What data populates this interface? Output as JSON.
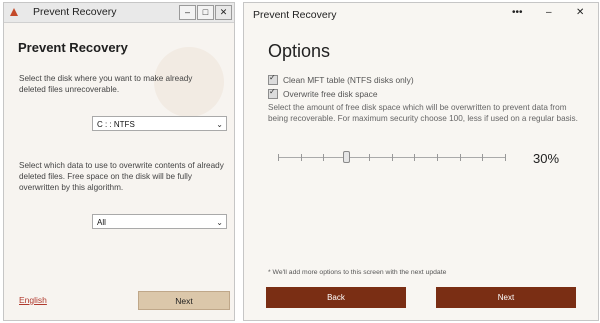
{
  "left_window": {
    "title": "Prevent Recovery",
    "controls": [
      "–",
      "□",
      "✕"
    ],
    "heading": "Prevent Recovery",
    "disk_prompt": "Select the disk where you want to make already deleted files unrecoverable.",
    "disk_select": "C : : NTFS",
    "data_prompt": "Select which data to use to overwrite contents of already deleted files. Free space on the disk will be fully overwritten by this algorithm.",
    "data_select": "All",
    "language_link": "English",
    "next_button": "Next"
  },
  "right_window": {
    "title": "Prevent Recovery",
    "more_label": "•••",
    "minimize_label": "–",
    "close_label": "✕",
    "heading": "Options",
    "options": [
      {
        "label": "Clean MFT table (NTFS disks only)",
        "checked": true
      },
      {
        "label": "Overwrite free disk space",
        "checked": true
      }
    ],
    "description": "Select the amount of free disk space which will be overwritten to prevent data from being recoverable. For maximum security choose 100, less if used on a regular basis.",
    "slider_value": 0.3,
    "percent_label": "30%",
    "footnote": "* We'll add more options to this screen with the next update",
    "back_button": "Back",
    "next_button": "Next"
  },
  "colors": {
    "accent": "#7a2e14",
    "left_panel": "#f7f4f0",
    "left_next": "#dbc7aa",
    "link": "#b03a2e"
  }
}
